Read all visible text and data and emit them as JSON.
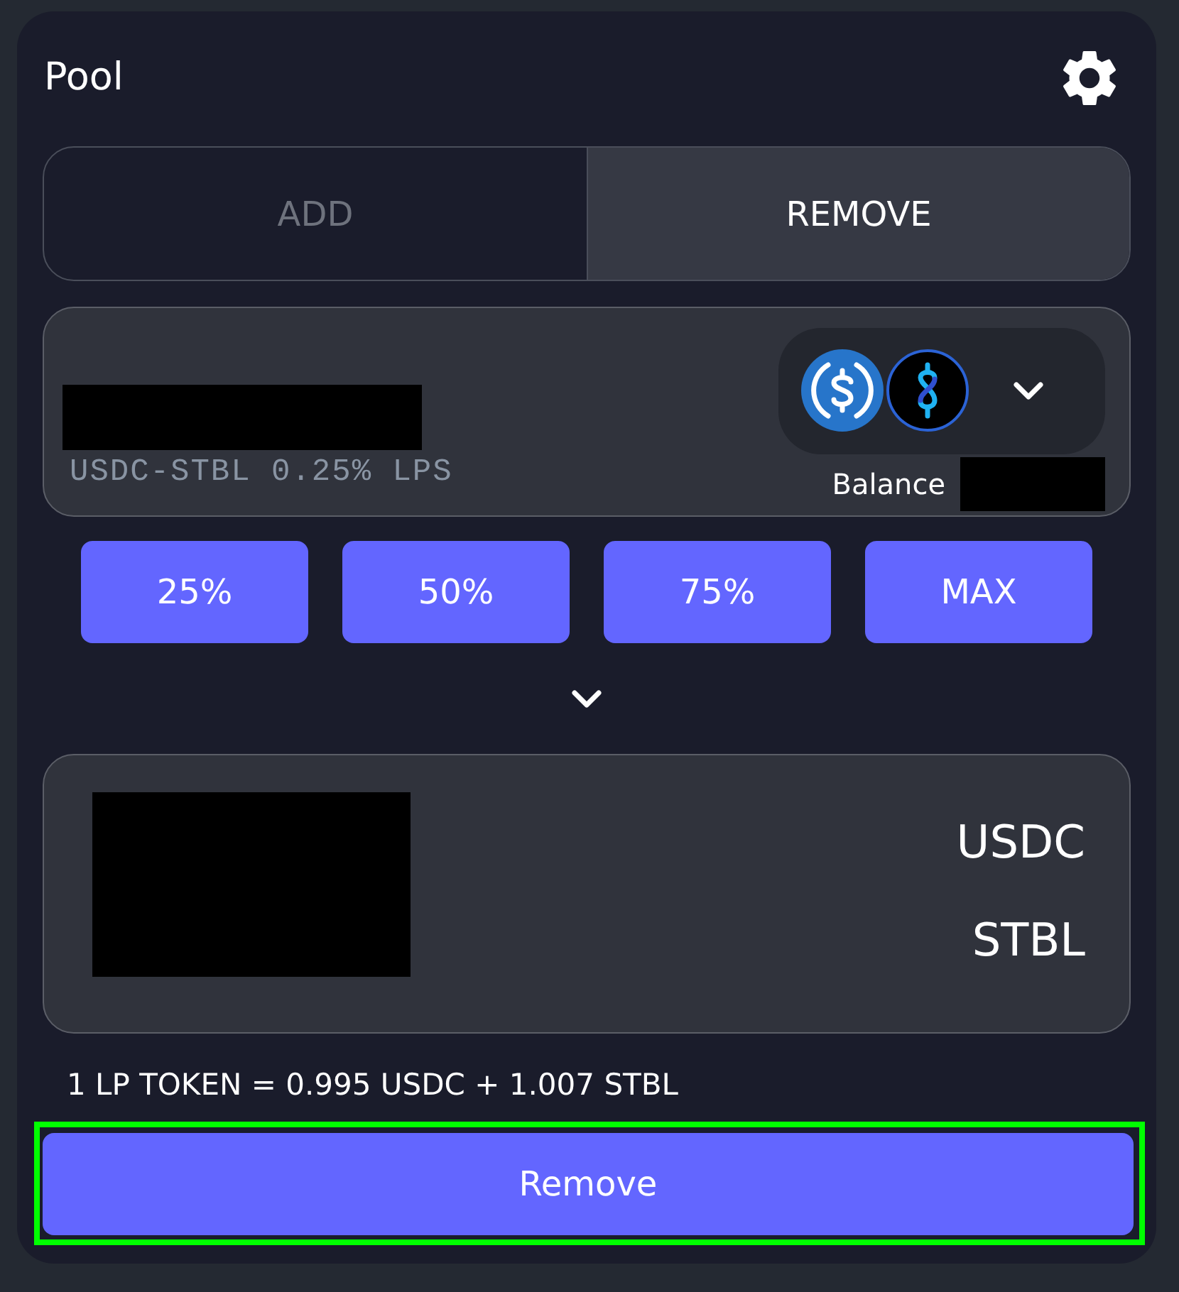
{
  "header": {
    "title": "Pool"
  },
  "mode_tabs": [
    {
      "label": "ADD",
      "selected": false
    },
    {
      "label": "REMOVE",
      "selected": true
    }
  ],
  "lp_input": {
    "token_label": "USDC-STBL 0.25% LPS",
    "balance_label": "Balance"
  },
  "percent_buttons": [
    "25%",
    "50%",
    "75%",
    "MAX"
  ],
  "output": {
    "tokens": [
      "USDC",
      "STBL"
    ]
  },
  "rate": "1 LP TOKEN = 0.995 USDC + 1.007 STBL",
  "submit": {
    "label": "Remove",
    "highlighted": true
  }
}
